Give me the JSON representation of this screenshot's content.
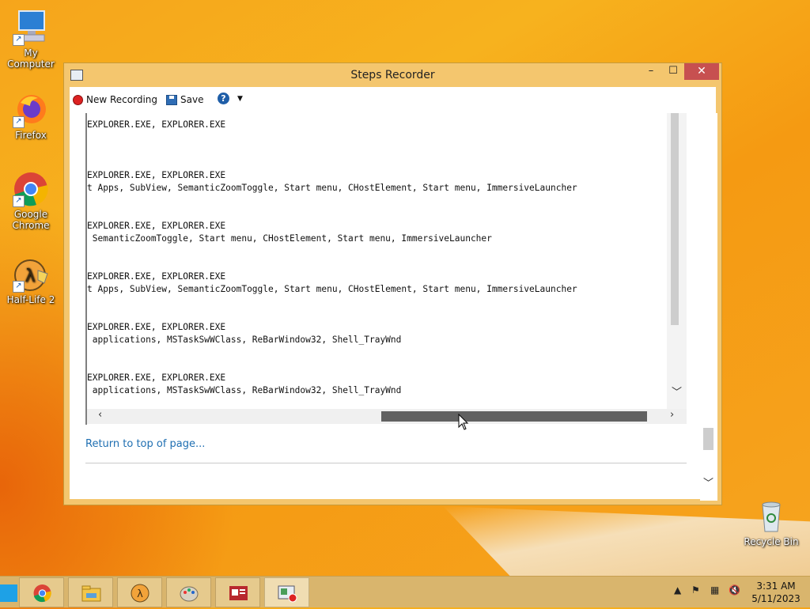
{
  "desktop": {
    "icons": [
      {
        "label": "My Computer"
      },
      {
        "label": "Firefox"
      },
      {
        "label": "Google Chrome"
      },
      {
        "label": "Half-Life 2"
      },
      {
        "label": "Recycle Bin"
      }
    ]
  },
  "window": {
    "title": "Steps Recorder",
    "buttons": {
      "minimize": "–",
      "maximize": "☐",
      "close": "✕"
    },
    "toolbar": {
      "new_recording": "New Recording",
      "save": "Save",
      "help": "?",
      "dropdown": "▼"
    },
    "content": {
      "lines": [
        "EXPLORER.EXE, EXPLORER.EXE",
        "EXPLORER.EXE, EXPLORER.EXE",
        "t Apps, SubView, SemanticZoomToggle, Start menu, CHostElement, Start menu, ImmersiveLauncher",
        "EXPLORER.EXE, EXPLORER.EXE",
        " SemanticZoomToggle, Start menu, CHostElement, Start menu, ImmersiveLauncher",
        "EXPLORER.EXE, EXPLORER.EXE",
        "t Apps, SubView, SemanticZoomToggle, Start menu, CHostElement, Start menu, ImmersiveLauncher",
        "EXPLORER.EXE, EXPLORER.EXE",
        " applications, MSTaskSwWClass, ReBarWindow32, Shell_TrayWnd",
        "EXPLORER.EXE, EXPLORER.EXE",
        " applications, MSTaskSwWClass, ReBarWindow32, Shell_TrayWnd"
      ],
      "return_link": "Return to top of page..."
    }
  },
  "taskbar": {
    "apps": [
      "chrome-icon",
      "file-explorer-icon",
      "half-life-2-icon",
      "paint-icon",
      "news-icon",
      "steps-recorder-icon"
    ],
    "tray": {
      "time": "3:31 AM",
      "date": "5/11/2023"
    }
  },
  "colors": {
    "accent": "#f6a51b",
    "close": "#c75050",
    "link": "#1f6fb2"
  }
}
